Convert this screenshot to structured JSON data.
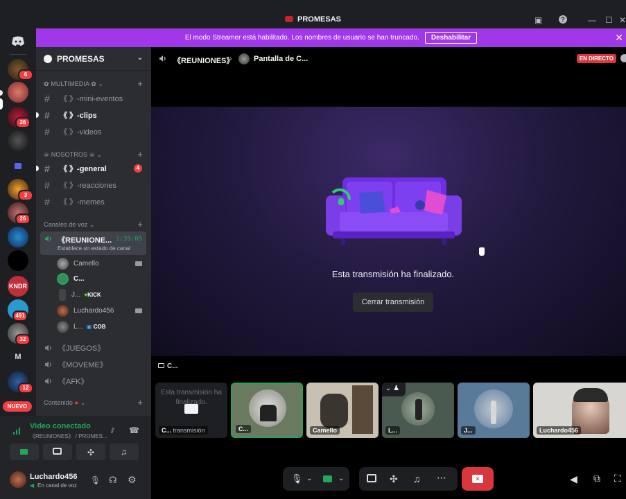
{
  "titlebar": {
    "title": "PROMESAS"
  },
  "rail": {
    "badges": [
      "6",
      "26",
      "3",
      "26",
      "491",
      "32",
      "12"
    ],
    "letter": "M",
    "new_label": "NUEVO"
  },
  "banner": {
    "text": "El modo Streamer está habilitado. Los nombres de usuario se han truncado.",
    "button": "Deshabilitar"
  },
  "guild": {
    "name": "PROMESAS"
  },
  "categories": {
    "multimedia": "MULTIMEDIA",
    "nosotros": "NOSOTROS",
    "voz": "Canales de voz",
    "contenido": "Contenido"
  },
  "channels": [
    {
      "label": "《 》-mini-eventos"
    },
    {
      "label": "《 》-clips"
    },
    {
      "label": "《 》-videos"
    },
    {
      "label": "《 》-general",
      "count": "4"
    },
    {
      "label": "《 》-reacciones"
    },
    {
      "label": "《 》-memes"
    }
  ],
  "voice": {
    "active": {
      "name": "《REUNIONE...",
      "time": "1:35:05",
      "status": "Establece un estado de canal"
    },
    "users": [
      {
        "name": "Camello",
        "tag": ""
      },
      {
        "name": "C...",
        "tag": ""
      },
      {
        "name": "J...",
        "tag": "KICK"
      },
      {
        "name": "Luchardo456",
        "tag": ""
      },
      {
        "name": "L...",
        "tag": "COB"
      }
    ],
    "channels": [
      "《JUEGOS》",
      "《MOVEME》",
      "《AFK》"
    ]
  },
  "vpanel": {
    "title": "Video conectado",
    "subtitle": "《REUNIONES》 / PROMES..."
  },
  "user": {
    "name": "Luchardo456",
    "status": "En canal de voz"
  },
  "stage": {
    "channel": "《REUNIONES》",
    "screen_label": "Pantalla de C...",
    "live": "EN DIRECTO",
    "ended": "Esta transmisión ha finalizado.",
    "close_button": "Cerrar transmisión",
    "stream_label": "C...",
    "tiles": [
      {
        "name": "C...",
        "overlay": "Esta transmisión ha finalizado.",
        "sub": "transmisión"
      },
      {
        "name": "C..."
      },
      {
        "name": "Camello"
      },
      {
        "name": "L..."
      },
      {
        "name": "J..."
      },
      {
        "name": "Luchardo456"
      }
    ]
  },
  "colors": {
    "accent": "#a037e9",
    "live": "#da373c",
    "connected": "#23a55a",
    "badge": "#f23f43"
  }
}
